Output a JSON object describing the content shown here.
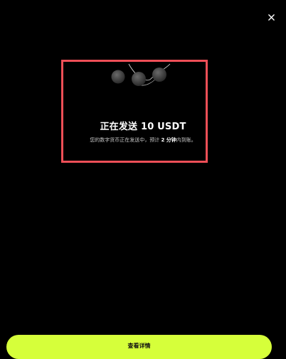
{
  "header": {
    "close_icon": "close-icon"
  },
  "status": {
    "title": "正在发送 10 USDT",
    "subtitle_prefix": "您的数字货币正在发送中，预计 ",
    "subtitle_emphasis": "2 分钟",
    "subtitle_suffix": "内到账。",
    "animation_icon": "sending-coins-icon"
  },
  "footer": {
    "view_details_label": "查看详情"
  },
  "colors": {
    "background": "#000000",
    "accent": "#d6ff3a",
    "highlight_outline": "#ee4f57"
  }
}
